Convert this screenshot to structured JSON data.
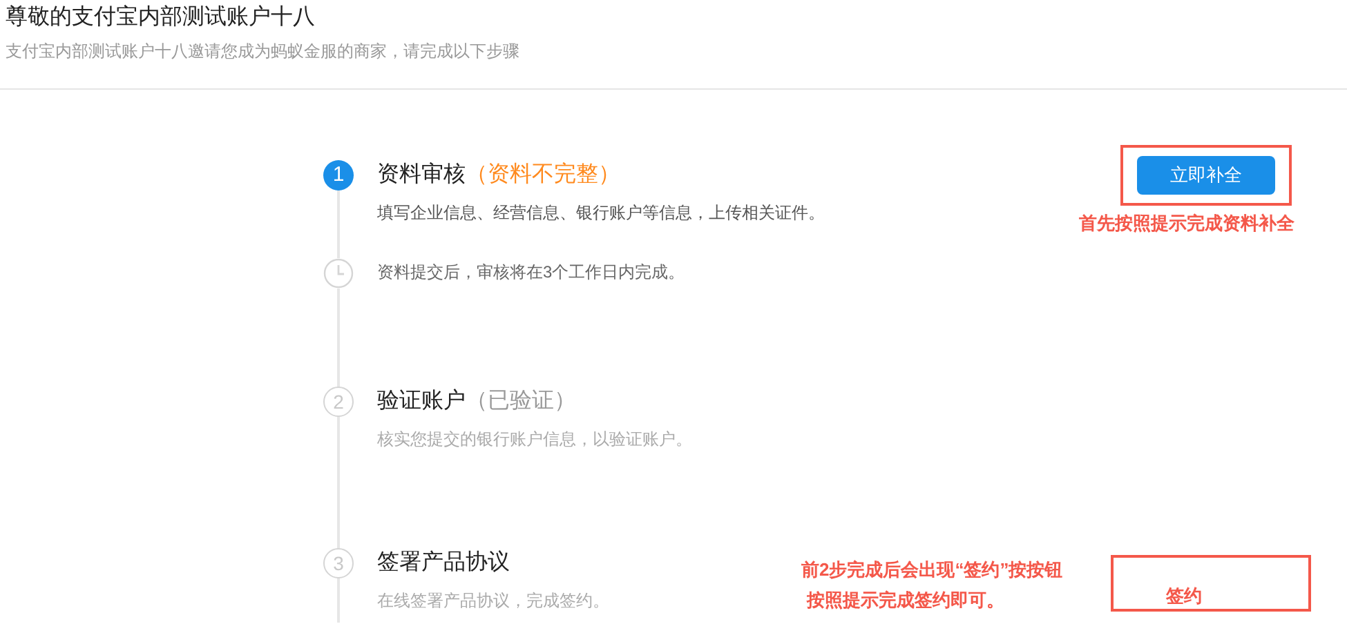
{
  "header": {
    "title": "尊敬的支付宝内部测试账户十八",
    "subtitle": "支付宝内部测试账户十八邀请您成为蚂蚁金服的商家，请完成以下步骤"
  },
  "steps": [
    {
      "kind": "number",
      "marker": "1",
      "active": true,
      "title": "资料审核",
      "status": "（资料不完整）",
      "incomplete": true,
      "description": "填写企业信息、经营信息、银行账户等信息，上传相关证件。"
    },
    {
      "kind": "clock",
      "active": false,
      "description": "资料提交后，审核将在3个工作日内完成。"
    },
    {
      "kind": "number",
      "marker": "2",
      "active": false,
      "title": "验证账户",
      "status": "（已验证）",
      "incomplete": false,
      "description": "核实您提交的银行账户信息，以验证账户。"
    },
    {
      "kind": "number",
      "marker": "3",
      "active": false,
      "title": "签署产品协议",
      "description": "在线签署产品协议，完成签约。"
    }
  ],
  "action_button": {
    "label": "立即补全"
  },
  "annotations": [
    {
      "kind": "button_note",
      "lines": [
        "首先按照提示完成资料补全"
      ]
    },
    {
      "kind": "sign_note",
      "lines": [
        "前2步完成后会出现“签约”按按钮",
        "按照提示完成签约即可。"
      ],
      "box_label": "签约"
    }
  ]
}
